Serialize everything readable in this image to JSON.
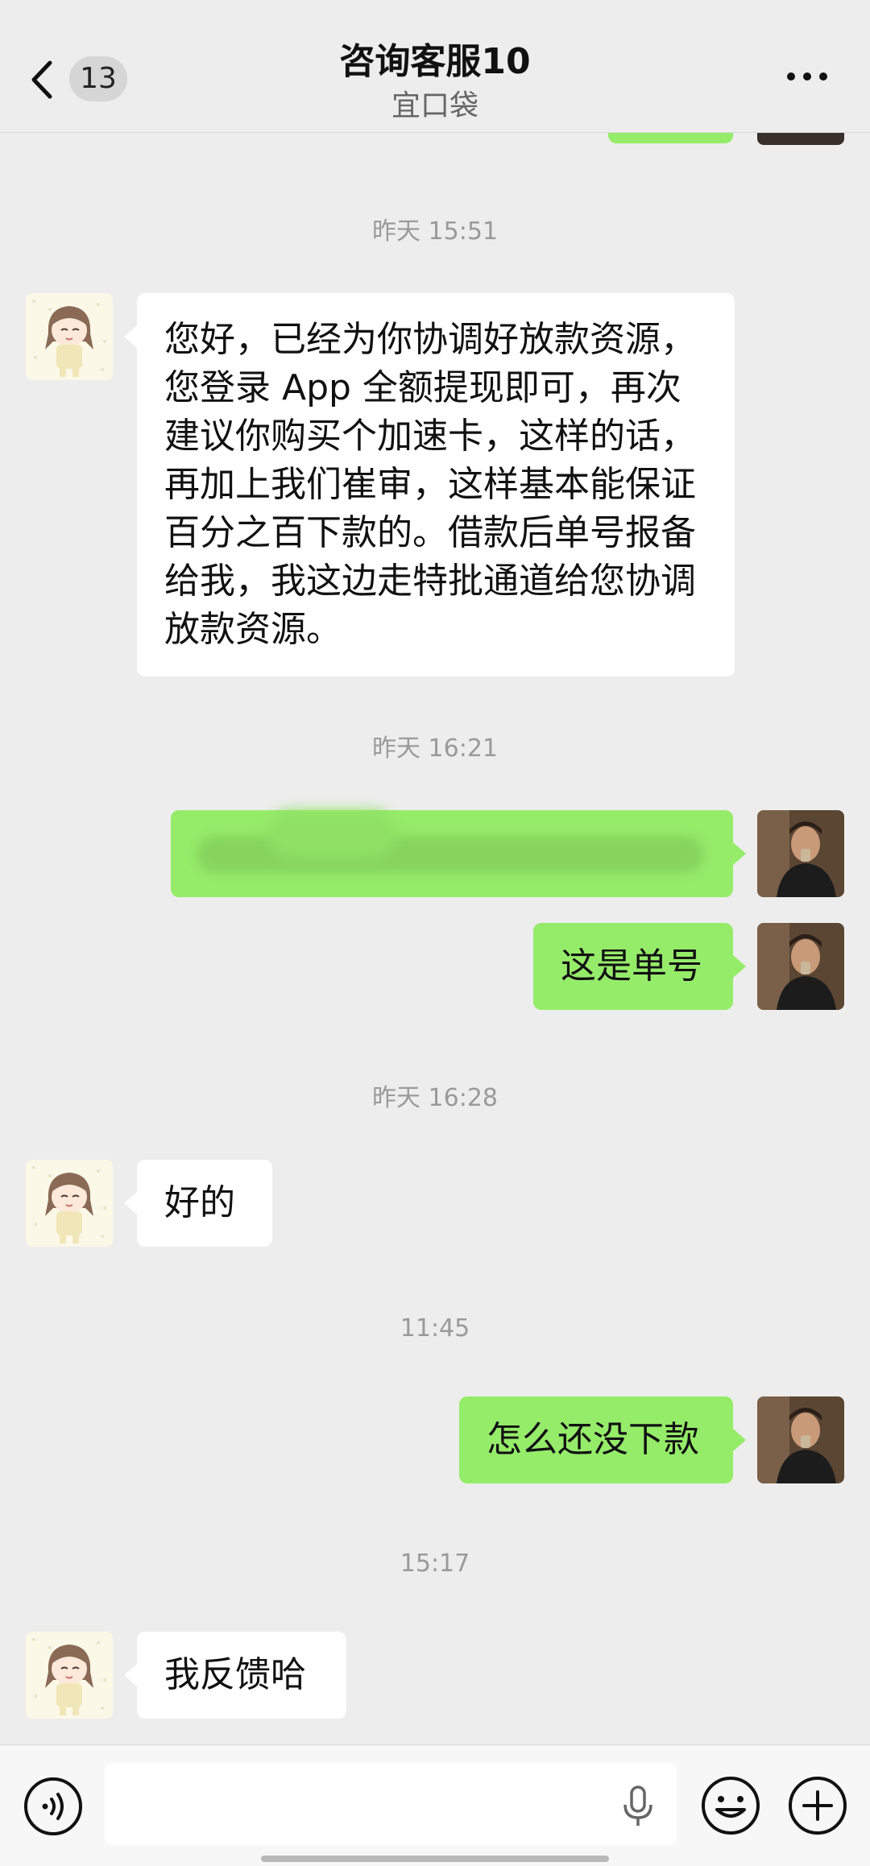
{
  "header": {
    "back_count": "13",
    "title": "咨询客服10",
    "subtitle": "宜口袋"
  },
  "messages": {
    "t1": "昨天 15:51",
    "m1": "您好，已经为你协调好放款资源，您登录 App 全额提现即可，再次建议你购买个加速卡，这样的话，再加上我们崔审，这样基本能保证百分之百下款的。借款后单号报备给我，我这边走特批通道给您协调放款资源。",
    "t2": "昨天 16:21",
    "m3": "这是单号",
    "t3": "昨天 16:28",
    "m4": "好的",
    "t4": "11:45",
    "m5": "怎么还没下款",
    "t5": "15:17",
    "m6": "我反馈哈"
  },
  "colors": {
    "sent_bubble": "#95ec69",
    "received_bubble": "#ffffff",
    "background": "#ededed"
  },
  "icons": {
    "back": "chevron-left-icon",
    "more": "more-dots-icon",
    "voice": "voice-icon",
    "mic": "microphone-icon",
    "emoji": "emoji-icon",
    "plus": "plus-icon"
  }
}
